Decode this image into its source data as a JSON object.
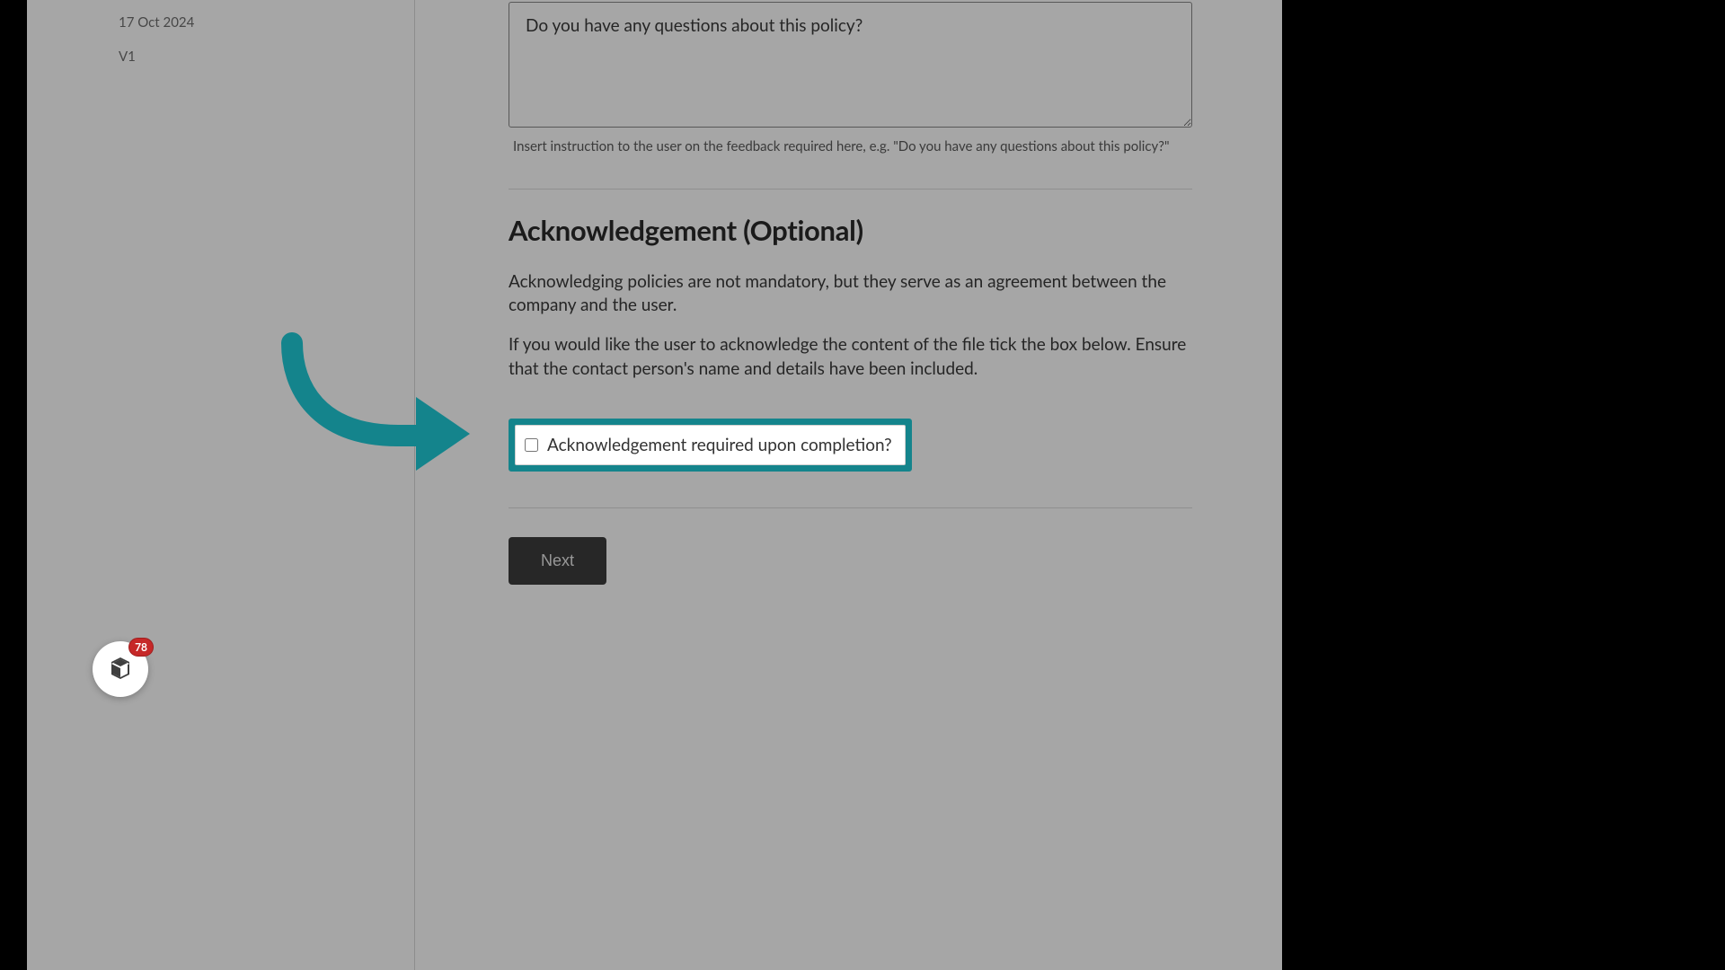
{
  "sidebar": {
    "date": "17 Oct 2024",
    "version": "V1"
  },
  "feedback": {
    "textarea_value": "Do you have any questions about this policy?",
    "hint": "Insert instruction to the user on the feedback required here, e.g. \"Do you have any questions about this policy?\""
  },
  "ack": {
    "heading": "Acknowledgement (Optional)",
    "para1": "Acknowledging policies are not mandatory, but they serve as an agreement between the company and the user.",
    "para2": "If you would like the user to acknowledge the content of the file tick the box below. Ensure that the contact person's name and details have been included.",
    "checkbox_label": "Acknowledgement required upon completion?"
  },
  "actions": {
    "next": "Next"
  },
  "chat": {
    "badge": "78"
  },
  "colors": {
    "highlight": "#14848c"
  }
}
